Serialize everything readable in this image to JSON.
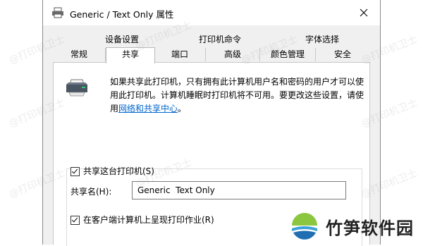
{
  "window": {
    "title": "Generic / Text Only 属性"
  },
  "tabs": {
    "row1": [
      "设备设置",
      "打印机命令",
      "字体选择"
    ],
    "row2": [
      "常规",
      "共享",
      "端口",
      "高级",
      "颜色管理",
      "安全"
    ],
    "active": "共享"
  },
  "sharing": {
    "description": "如果共享此打印机，只有拥有此计算机用户名和密码的用户才可以使用此打印机。计算机睡眠时打印机将不可用。要更改这些设置，请使用",
    "link_text": "网络和共享中心",
    "link_suffix": "。",
    "share_checkbox_label": "共享这台打印机(S)",
    "share_checked": true,
    "share_name_label": "共享名(H):",
    "share_name_value": "Generic  Text Only",
    "render_checkbox_label": "在客户端计算机上呈现打印作业(R)",
    "render_checked": true
  },
  "watermark": {
    "text": "@打印机卫士"
  },
  "brand": {
    "name": "竹笋软件园"
  }
}
